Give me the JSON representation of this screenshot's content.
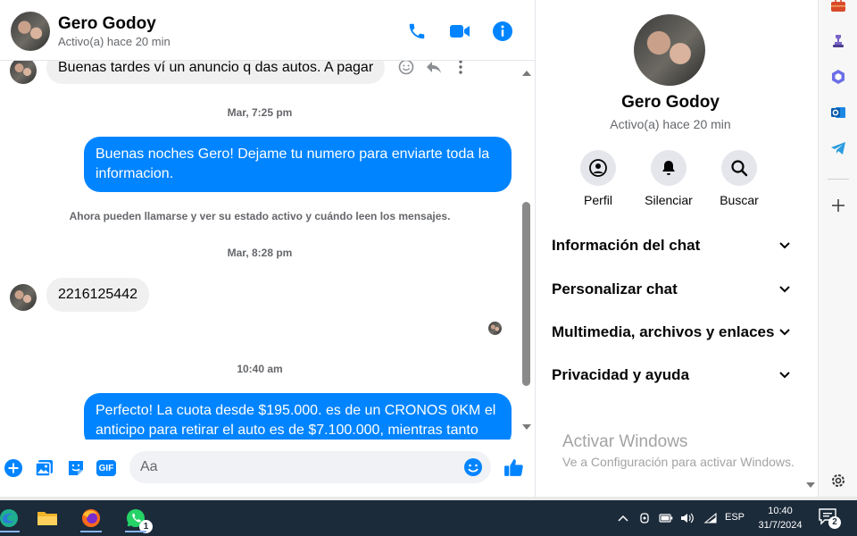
{
  "colors": {
    "brand": "#0084ff",
    "incoming_bubble": "#f0f0f0",
    "muted_text": "#65676b",
    "taskbar": "#1c2b3a"
  },
  "header": {
    "name": "Gero Godoy",
    "status": "Activo(a) hace 20 min",
    "icons": [
      "phone-icon",
      "video-camera-icon",
      "info-icon"
    ]
  },
  "messages": [
    {
      "type": "incoming",
      "text": "Buenas tardes ví un anuncio q das autos. A pagar"
    },
    {
      "type": "timestamp",
      "text": "Mar, 7:25 pm"
    },
    {
      "type": "outgoing",
      "text": "Buenas noches Gero! Dejame tu numero para enviarte toda la informacion."
    },
    {
      "type": "notice",
      "text": "Ahora pueden llamarse y ver su estado activo y cuándo leen los mensajes."
    },
    {
      "type": "timestamp",
      "text": "Mar, 8:28 pm"
    },
    {
      "type": "incoming",
      "text": "2216125442"
    },
    {
      "type": "timestamp",
      "text": "10:40 am"
    },
    {
      "type": "outgoing",
      "text": "Perfecto! La cuota desde $195.000. es de un CRONOS 0KM el anticipo para retirar el auto es de $7.100.000, mientras tanto"
    }
  ],
  "composer": {
    "placeholder": "Aa",
    "icons": [
      "plus-icon",
      "image-icon",
      "sticker-icon",
      "gif-icon",
      "emoji-icon",
      "thumbs-up-icon"
    ],
    "gif_label": "GIF"
  },
  "panel": {
    "name": "Gero Godoy",
    "status": "Activo(a) hace 20 min",
    "actions": [
      {
        "label": "Perfil",
        "icon": "profile-icon"
      },
      {
        "label": "Silenciar",
        "icon": "bell-icon"
      },
      {
        "label": "Buscar",
        "icon": "search-icon"
      }
    ],
    "sections": [
      "Información del chat",
      "Personalizar chat",
      "Multimedia, archivos y enlaces",
      "Privacidad y ayuda"
    ]
  },
  "watermark": {
    "title": "Activar Windows",
    "subtitle": "Ve a Configuración para activar Windows."
  },
  "edge_sidebar": {
    "icons": [
      "toolbox-icon",
      "games-icon",
      "copilot-icon",
      "outlook-icon",
      "telegram-icon",
      "add-icon",
      "settings-icon"
    ]
  },
  "taskbar": {
    "apps": [
      "edge-icon",
      "file-explorer-icon",
      "firefox-icon",
      "whatsapp-icon"
    ],
    "whatsapp_badge": "1",
    "tray_icons": [
      "chevron-up-icon",
      "meet-now-icon",
      "battery-icon",
      "volume-icon",
      "wifi-icon"
    ],
    "language": "ESP",
    "time": "10:40",
    "date": "31/7/2024",
    "notifications": "2"
  }
}
